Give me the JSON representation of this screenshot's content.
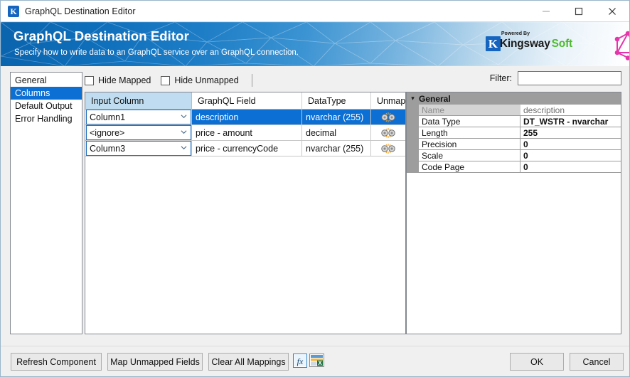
{
  "window": {
    "title": "GraphQL Destination Editor",
    "app_icon": "kingswaysoft-k-icon",
    "controls": {
      "minimize": "–",
      "maximize": "▢",
      "close": "✕"
    }
  },
  "banner": {
    "title": "GraphQL Destination Editor",
    "subtitle": "Specify how to write data to an GraphQL service over an GraphQL connection.",
    "powered_by": "Powered By",
    "brand_first": "Kingsway",
    "brand_second": "Soft",
    "brand_initial": "K",
    "accent_blue": "#1565c0",
    "accent_green": "#4cbb2c",
    "graphql_pink": "#e535ab"
  },
  "sidebar": {
    "items": [
      {
        "label": "General",
        "selected": false
      },
      {
        "label": "Columns",
        "selected": true
      },
      {
        "label": "Default Output",
        "selected": false
      },
      {
        "label": "Error Handling",
        "selected": false
      }
    ]
  },
  "toolbar": {
    "hide_mapped_label": "Hide Mapped",
    "hide_mapped_checked": false,
    "hide_unmapped_label": "Hide Unmapped",
    "hide_unmapped_checked": false,
    "filter_label": "Filter:",
    "filter_value": "",
    "filter_placeholder": ""
  },
  "grid": {
    "columns": [
      "Input Column",
      "GraphQL Field",
      "DataType",
      "Unmap"
    ],
    "rows": [
      {
        "input_column": "Column1",
        "graphql_field": "description",
        "data_type": "nvarchar (255)",
        "unmap_icon": "unmap-link-icon",
        "selected": true
      },
      {
        "input_column": "<ignore>",
        "graphql_field": "price - amount",
        "data_type": "decimal",
        "unmap_icon": "unmap-link-icon",
        "selected": false
      },
      {
        "input_column": "Column3",
        "graphql_field": "price - currencyCode",
        "data_type": "nvarchar (255)",
        "unmap_icon": "unmap-link-icon",
        "selected": false
      }
    ]
  },
  "properties": {
    "category": "General",
    "rows": [
      {
        "name": "Name",
        "value": "description",
        "readonly": true
      },
      {
        "name": "Data Type",
        "value": "DT_WSTR - nvarchar",
        "readonly": false
      },
      {
        "name": "Length",
        "value": "255",
        "readonly": false
      },
      {
        "name": "Precision",
        "value": "0",
        "readonly": false
      },
      {
        "name": "Scale",
        "value": "0",
        "readonly": false
      },
      {
        "name": "Code Page",
        "value": "0",
        "readonly": false
      }
    ]
  },
  "footer": {
    "refresh_component": "Refresh Component",
    "map_unmapped_fields": "Map Unmapped Fields",
    "clear_all_mappings": "Clear All Mappings",
    "expression_icon": "fx-expression-icon",
    "export_icon": "export-spreadsheet-icon",
    "ok": "OK",
    "cancel": "Cancel"
  }
}
